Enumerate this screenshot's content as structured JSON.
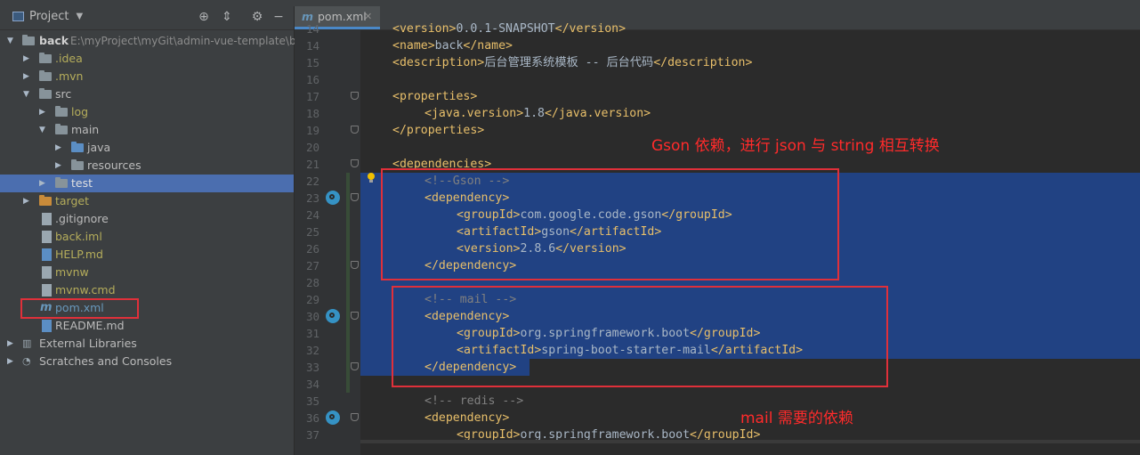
{
  "project_panel": {
    "title": "Project",
    "header_icons": [
      "target-icon",
      "collapse-icon",
      "gear-icon",
      "minimize-icon"
    ],
    "root": {
      "name": "back",
      "path": "E:\\myProject\\myGit\\admin-vue-template\\ba"
    },
    "items": [
      {
        "label": ".idea"
      },
      {
        "label": ".mvn"
      },
      {
        "label": "src"
      },
      {
        "label": "log"
      },
      {
        "label": "main"
      },
      {
        "label": "java"
      },
      {
        "label": "resources"
      },
      {
        "label": "test"
      },
      {
        "label": "target"
      },
      {
        "label": ".gitignore"
      },
      {
        "label": "back.iml"
      },
      {
        "label": "HELP.md"
      },
      {
        "label": "mvnw"
      },
      {
        "label": "mvnw.cmd"
      },
      {
        "label": "pom.xml"
      },
      {
        "label": "README.md"
      },
      {
        "label": "External Libraries"
      },
      {
        "label": "Scratches and Consoles"
      }
    ]
  },
  "editor": {
    "tab": {
      "label": "pom.xml"
    },
    "lines": [
      {
        "n": "14",
        "text": "<version>0.0.1-SNAPSHOT</version>"
      },
      {
        "n": "14",
        "text": "<name>back</name>"
      },
      {
        "n": "15",
        "text": "<description>后台管理系统模板 -- 后台代码</description>"
      },
      {
        "n": "16",
        "text": ""
      },
      {
        "n": "17",
        "text": "<properties>"
      },
      {
        "n": "18",
        "text": "<java.version>1.8</java.version>"
      },
      {
        "n": "19",
        "text": "</properties>"
      },
      {
        "n": "20",
        "text": ""
      },
      {
        "n": "21",
        "text": "<dependencies>"
      },
      {
        "n": "22",
        "text": "<!--Gson -->"
      },
      {
        "n": "23",
        "text": "<dependency>"
      },
      {
        "n": "24",
        "text": "<groupId>com.google.code.gson</groupId>"
      },
      {
        "n": "25",
        "text": "<artifactId>gson</artifactId>"
      },
      {
        "n": "26",
        "text": "<version>2.8.6</version>"
      },
      {
        "n": "27",
        "text": "</dependency>"
      },
      {
        "n": "28",
        "text": ""
      },
      {
        "n": "29",
        "text": "<!-- mail -->"
      },
      {
        "n": "30",
        "text": "<dependency>"
      },
      {
        "n": "31",
        "text": "<groupId>org.springframework.boot</groupId>"
      },
      {
        "n": "32",
        "text": "<artifactId>spring-boot-starter-mail</artifactId>"
      },
      {
        "n": "33",
        "text": "</dependency>"
      },
      {
        "n": "34",
        "text": ""
      },
      {
        "n": "35",
        "text": "<!-- redis -->"
      },
      {
        "n": "36",
        "text": "<dependency>"
      },
      {
        "n": "37",
        "text": "<groupId>org.springframework.boot</groupId>"
      }
    ]
  },
  "annotations": {
    "gson": "Gson 依赖，进行 json 与 string 相互转换",
    "mail": "mail 需要的依赖"
  },
  "colors": {
    "selection": "#214283",
    "tree_selection": "#4b6eaf",
    "tag": "#e8bf6a",
    "comment": "#808080",
    "annotation_red": "#ff2b2b"
  }
}
